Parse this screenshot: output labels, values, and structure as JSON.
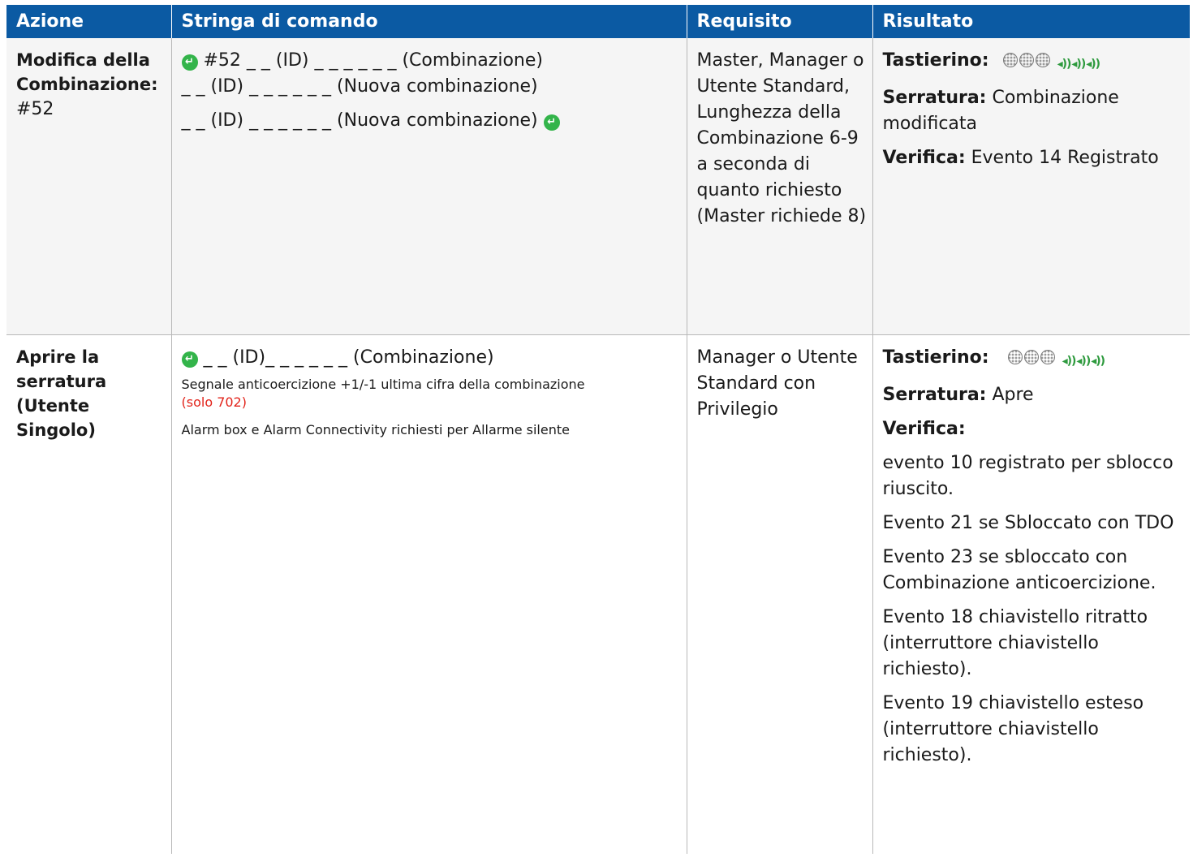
{
  "headers": {
    "action": "Azione",
    "command": "Stringa di comando",
    "requirement": "Requisito",
    "result": "Risultato"
  },
  "icons": {
    "enter": "green-enter-icon",
    "keypad": "keypad-icon",
    "beep": "speaker-beep-icon"
  },
  "colors": {
    "header_bg": "#0b5aa3",
    "enter_green": "#33b44a",
    "beep_green": "#2e9a3e",
    "note_red": "#e2231a"
  },
  "rows": [
    {
      "action_bold": "Modifica della Combinazione:",
      "action_rest": "#52",
      "cmd_line1": "#52 _ _ (ID) _ _ _ _ _ _ (Combinazione)",
      "cmd_line2": "_ _ (ID) _ _ _ _ _ _ (Nuova combinazione)",
      "cmd_line3": "_ _ (ID) _ _ _ _ _ _ (Nuova combinazione)",
      "requirement": "Master, Manager o Utente Standard, Lunghezza della Combinazione 6-9 a seconda di quanto richiesto (Master richiede 8)",
      "result": {
        "keypad_label": "Tastierino:",
        "lock_label": "Serratura:",
        "lock_value": "Combinazione modificata",
        "audit_label": "Verifica:",
        "audit_value": "Evento 14 Registrato"
      }
    },
    {
      "action_bold": "Aprire la serratura (Utente Singolo)",
      "cmd_line1": "_ _ (ID)_ _ _ _ _ _ (Combinazione)",
      "duress_note": "Segnale anticoercizione +1/-1 ultima cifra della combinazione",
      "duress_red": "(solo 702)",
      "alarm_note": "Alarm box e Alarm Connectivity richiesti per Allarme silente",
      "requirement": "Manager o Utente Standard con Privilegio",
      "result": {
        "keypad_label": "Tastierino:",
        "lock_label": "Serratura:",
        "lock_value": "Apre",
        "audit_label": "Verifica:",
        "events": [
          "evento 10 registrato per sblocco riuscito.",
          "Evento 21 se Sbloccato con TDO",
          "Evento 23 se sbloccato con Combinazione anticoercizione.",
          "Evento 18 chiavistello ritratto (interruttore chiavistello richiesto).",
          "Evento 19 chiavistello esteso (interruttore chiavistello richiesto)."
        ]
      }
    }
  ]
}
